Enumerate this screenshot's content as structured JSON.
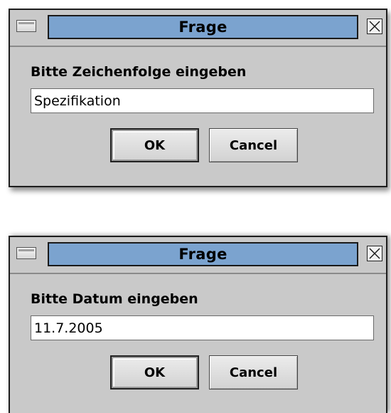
{
  "dialogs": [
    {
      "title": "Frage",
      "prompt": "Bitte Zeichenfolge eingeben",
      "input_value": "Spezifikation",
      "ok_label": "OK",
      "cancel_label": "Cancel"
    },
    {
      "title": "Frage",
      "prompt": "Bitte Datum eingeben",
      "input_value": "11.7.2005",
      "ok_label": "OK",
      "cancel_label": "Cancel"
    }
  ],
  "colors": {
    "title_bar": "#7ba3cf",
    "dialog_background": "#c9c9c9"
  },
  "icons": {
    "window_menu": "window-menu-icon",
    "close": "close-icon"
  }
}
